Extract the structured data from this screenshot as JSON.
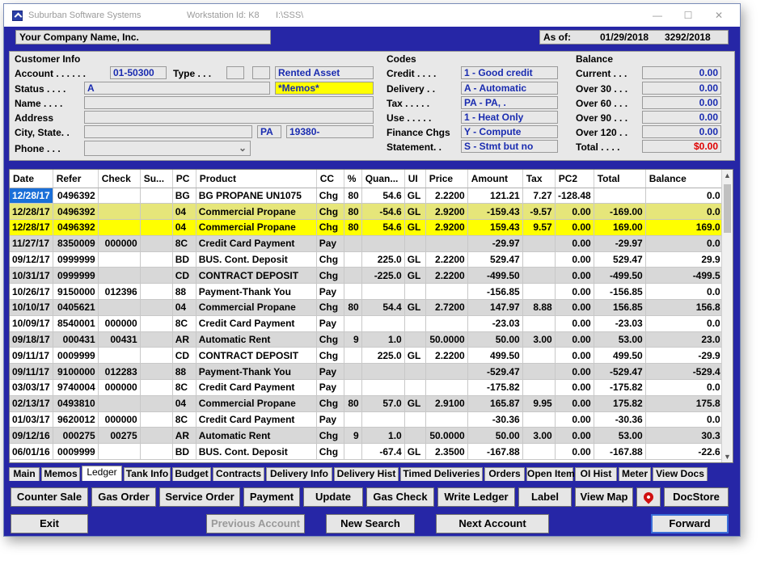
{
  "window": {
    "app_title": "Suburban Software Systems",
    "workstation": "Workstation Id: K8",
    "path": "I:\\SSS\\",
    "minimize": "—",
    "maximize": "☐",
    "close": "✕"
  },
  "header": {
    "company": "Your Company Name, Inc.",
    "as_of_label": "As of:",
    "as_of_date": "01/29/2018",
    "as_of_number": "3292/2018"
  },
  "customer_info": {
    "title": "Customer Info",
    "account_label": "Account . . . . . .",
    "account": "01-50300",
    "type_label": "Type . . .",
    "rented_asset": "Rented Asset",
    "status_label": "Status . . . .",
    "status": "A",
    "memos": "*Memos*",
    "name_label": "Name . . . .",
    "address_label": "Address",
    "city_label": "City, State. .",
    "state": "PA",
    "zip": "19380-",
    "phone_label": "Phone . . .",
    "phone_dropdown": "⌄"
  },
  "codes": {
    "title": "Codes",
    "credit_label": "Credit . . . .",
    "credit": "1 - Good credit",
    "delivery_label": "Delivery . .",
    "delivery": "A - Automatic",
    "tax_label": "Tax . . . . .",
    "tax": "PA - PA, .",
    "use_label": "Use . . . . .",
    "use": "1 - Heat Only",
    "finance_label": "Finance Chgs",
    "finance": "Y - Compute",
    "statement_label": "Statement. .",
    "statement": "S - Stmt but no"
  },
  "balance": {
    "title": "Balance",
    "current_label": "Current . . .",
    "current": "0.00",
    "over30_label": "Over 30 . . .",
    "over30": "0.00",
    "over60_label": "Over 60 . . .",
    "over60": "0.00",
    "over90_label": "Over 90 . . .",
    "over90": "0.00",
    "over120_label": "Over 120 . .",
    "over120": "0.00",
    "total_label": "Total . . . .",
    "total": "$0.00",
    "total_color": "#e00000"
  },
  "ledger": {
    "columns": [
      "Date",
      "Refer",
      "Check",
      "Su...",
      "PC",
      "Product",
      "CC",
      "%",
      "Quan...",
      "UI",
      "Price",
      "Amount",
      "Tax",
      "PC2",
      "Total",
      "Balance"
    ],
    "rows": [
      {
        "style": "white",
        "cells": [
          "12/28/17",
          "0496392",
          "",
          "",
          "BG",
          "BG PROPANE UN1075",
          "Chg",
          "80",
          "54.6",
          "GL",
          "2.2200",
          "121.21",
          "7.27",
          "-128.48",
          "",
          "0.0"
        ]
      },
      {
        "style": "hl",
        "cells": [
          "12/28/17",
          "0496392",
          "",
          "",
          "04",
          "Commercial Propane",
          "Chg",
          "80",
          "-54.6",
          "GL",
          "2.9200",
          "-159.43",
          "-9.57",
          "0.00",
          "-169.00",
          "0.0"
        ]
      },
      {
        "style": "yl",
        "cells": [
          "12/28/17",
          "0496392",
          "",
          "",
          "04",
          "Commercial Propane",
          "Chg",
          "80",
          "54.6",
          "GL",
          "2.9200",
          "159.43",
          "9.57",
          "0.00",
          "169.00",
          "169.0"
        ]
      },
      {
        "style": "gray",
        "cells": [
          "11/27/17",
          "8350009",
          "000000",
          "",
          "8C",
          "Credit Card Payment",
          "Pay",
          "",
          "",
          "",
          "",
          "-29.97",
          "",
          "0.00",
          "-29.97",
          "0.0"
        ]
      },
      {
        "style": "white",
        "cells": [
          "09/12/17",
          "0999999",
          "",
          "",
          "BD",
          "BUS. Cont. Deposit",
          "Chg",
          "",
          "225.0",
          "GL",
          "2.2200",
          "529.47",
          "",
          "0.00",
          "529.47",
          "29.9"
        ]
      },
      {
        "style": "gray",
        "cells": [
          "10/31/17",
          "0999999",
          "",
          "",
          "CD",
          "CONTRACT DEPOSIT",
          "Chg",
          "",
          "-225.0",
          "GL",
          "2.2200",
          "-499.50",
          "",
          "0.00",
          "-499.50",
          "-499.5"
        ]
      },
      {
        "style": "white",
        "cells": [
          "10/26/17",
          "9150000",
          "012396",
          "",
          "88",
          "Payment-Thank You",
          "Pay",
          "",
          "",
          "",
          "",
          "-156.85",
          "",
          "0.00",
          "-156.85",
          "0.0"
        ]
      },
      {
        "style": "gray",
        "cells": [
          "10/10/17",
          "0405621",
          "",
          "",
          "04",
          "Commercial Propane",
          "Chg",
          "80",
          "54.4",
          "GL",
          "2.7200",
          "147.97",
          "8.88",
          "0.00",
          "156.85",
          "156.8"
        ]
      },
      {
        "style": "white",
        "cells": [
          "10/09/17",
          "8540001",
          "000000",
          "",
          "8C",
          "Credit Card Payment",
          "Pay",
          "",
          "",
          "",
          "",
          "-23.03",
          "",
          "0.00",
          "-23.03",
          "0.0"
        ]
      },
      {
        "style": "gray",
        "cells": [
          "09/18/17",
          "000431",
          "00431",
          "",
          "AR",
          "Automatic Rent",
          "Chg",
          "9",
          "1.0",
          "",
          "50.0000",
          "50.00",
          "3.00",
          "0.00",
          "53.00",
          "23.0"
        ]
      },
      {
        "style": "white",
        "cells": [
          "09/11/17",
          "0009999",
          "",
          "",
          "CD",
          "CONTRACT DEPOSIT",
          "Chg",
          "",
          "225.0",
          "GL",
          "2.2200",
          "499.50",
          "",
          "0.00",
          "499.50",
          "-29.9"
        ]
      },
      {
        "style": "gray",
        "cells": [
          "09/11/17",
          "9100000",
          "012283",
          "",
          "88",
          "Payment-Thank You",
          "Pay",
          "",
          "",
          "",
          "",
          "-529.47",
          "",
          "0.00",
          "-529.47",
          "-529.4"
        ]
      },
      {
        "style": "white",
        "cells": [
          "03/03/17",
          "9740004",
          "000000",
          "",
          "8C",
          "Credit Card Payment",
          "Pay",
          "",
          "",
          "",
          "",
          "-175.82",
          "",
          "0.00",
          "-175.82",
          "0.0"
        ]
      },
      {
        "style": "gray",
        "cells": [
          "02/13/17",
          "0493810",
          "",
          "",
          "04",
          "Commercial Propane",
          "Chg",
          "80",
          "57.0",
          "GL",
          "2.9100",
          "165.87",
          "9.95",
          "0.00",
          "175.82",
          "175.8"
        ]
      },
      {
        "style": "white",
        "cells": [
          "01/03/17",
          "9620012",
          "000000",
          "",
          "8C",
          "Credit Card Payment",
          "Pay",
          "",
          "",
          "",
          "",
          "-30.36",
          "",
          "0.00",
          "-30.36",
          "0.0"
        ]
      },
      {
        "style": "gray",
        "cells": [
          "09/12/16",
          "000275",
          "00275",
          "",
          "AR",
          "Automatic Rent",
          "Chg",
          "9",
          "1.0",
          "",
          "50.0000",
          "50.00",
          "3.00",
          "0.00",
          "53.00",
          "30.3"
        ]
      },
      {
        "style": "white",
        "cells": [
          "06/01/16",
          "0009999",
          "",
          "",
          "BD",
          "BUS. Cont. Deposit",
          "Chg",
          "",
          "-67.4",
          "GL",
          "2.3500",
          "-167.88",
          "",
          "0.00",
          "-167.88",
          "-22.6"
        ]
      }
    ]
  },
  "tabs": [
    "Main",
    "Memos",
    "Ledger",
    "Tank Info",
    "Budget",
    "Contracts",
    "Delivery Info",
    "Delivery Hist",
    "Timed Deliveries",
    "Orders",
    "Open Item",
    "OI Hist",
    "Meter",
    "View Docs"
  ],
  "active_tab": "Ledger",
  "buttons": {
    "counter_sale": "Counter Sale",
    "gas_order": "Gas Order",
    "service_order": "Service Order",
    "payment": "Payment",
    "update": "Update",
    "gas_check": "Gas Check",
    "write_ledger": "Write Ledger",
    "label": "Label",
    "view_map": "View Map",
    "map_pin_icon": "map-pin-icon",
    "docstore": "DocStore",
    "exit": "Exit",
    "previous_account": "Previous Account",
    "new_search": "New Search",
    "next_account": "Next Account",
    "forward": "Forward"
  },
  "colors": {
    "client_bg": "#2626a6",
    "field_text": "#1a2cb0",
    "highlight_yellow": "#ffff00",
    "selection": "#1a6fd8"
  }
}
